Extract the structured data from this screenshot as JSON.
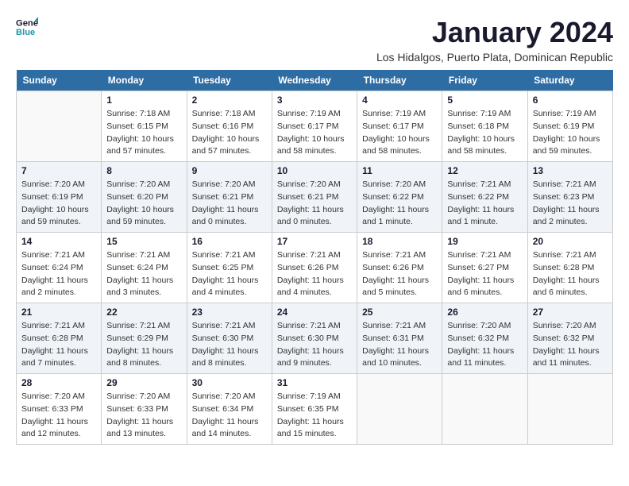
{
  "logo": {
    "line1": "General",
    "line2": "Blue"
  },
  "title": "January 2024",
  "subtitle": "Los Hidalgos, Puerto Plata, Dominican Republic",
  "days_of_week": [
    "Sunday",
    "Monday",
    "Tuesday",
    "Wednesday",
    "Thursday",
    "Friday",
    "Saturday"
  ],
  "weeks": [
    [
      {
        "day": "",
        "info": ""
      },
      {
        "day": "1",
        "info": "Sunrise: 7:18 AM\nSunset: 6:15 PM\nDaylight: 10 hours\nand 57 minutes."
      },
      {
        "day": "2",
        "info": "Sunrise: 7:18 AM\nSunset: 6:16 PM\nDaylight: 10 hours\nand 57 minutes."
      },
      {
        "day": "3",
        "info": "Sunrise: 7:19 AM\nSunset: 6:17 PM\nDaylight: 10 hours\nand 58 minutes."
      },
      {
        "day": "4",
        "info": "Sunrise: 7:19 AM\nSunset: 6:17 PM\nDaylight: 10 hours\nand 58 minutes."
      },
      {
        "day": "5",
        "info": "Sunrise: 7:19 AM\nSunset: 6:18 PM\nDaylight: 10 hours\nand 58 minutes."
      },
      {
        "day": "6",
        "info": "Sunrise: 7:19 AM\nSunset: 6:19 PM\nDaylight: 10 hours\nand 59 minutes."
      }
    ],
    [
      {
        "day": "7",
        "info": "Sunrise: 7:20 AM\nSunset: 6:19 PM\nDaylight: 10 hours\nand 59 minutes."
      },
      {
        "day": "8",
        "info": "Sunrise: 7:20 AM\nSunset: 6:20 PM\nDaylight: 10 hours\nand 59 minutes."
      },
      {
        "day": "9",
        "info": "Sunrise: 7:20 AM\nSunset: 6:21 PM\nDaylight: 11 hours\nand 0 minutes."
      },
      {
        "day": "10",
        "info": "Sunrise: 7:20 AM\nSunset: 6:21 PM\nDaylight: 11 hours\nand 0 minutes."
      },
      {
        "day": "11",
        "info": "Sunrise: 7:20 AM\nSunset: 6:22 PM\nDaylight: 11 hours\nand 1 minute."
      },
      {
        "day": "12",
        "info": "Sunrise: 7:21 AM\nSunset: 6:22 PM\nDaylight: 11 hours\nand 1 minute."
      },
      {
        "day": "13",
        "info": "Sunrise: 7:21 AM\nSunset: 6:23 PM\nDaylight: 11 hours\nand 2 minutes."
      }
    ],
    [
      {
        "day": "14",
        "info": "Sunrise: 7:21 AM\nSunset: 6:24 PM\nDaylight: 11 hours\nand 2 minutes."
      },
      {
        "day": "15",
        "info": "Sunrise: 7:21 AM\nSunset: 6:24 PM\nDaylight: 11 hours\nand 3 minutes."
      },
      {
        "day": "16",
        "info": "Sunrise: 7:21 AM\nSunset: 6:25 PM\nDaylight: 11 hours\nand 4 minutes."
      },
      {
        "day": "17",
        "info": "Sunrise: 7:21 AM\nSunset: 6:26 PM\nDaylight: 11 hours\nand 4 minutes."
      },
      {
        "day": "18",
        "info": "Sunrise: 7:21 AM\nSunset: 6:26 PM\nDaylight: 11 hours\nand 5 minutes."
      },
      {
        "day": "19",
        "info": "Sunrise: 7:21 AM\nSunset: 6:27 PM\nDaylight: 11 hours\nand 6 minutes."
      },
      {
        "day": "20",
        "info": "Sunrise: 7:21 AM\nSunset: 6:28 PM\nDaylight: 11 hours\nand 6 minutes."
      }
    ],
    [
      {
        "day": "21",
        "info": "Sunrise: 7:21 AM\nSunset: 6:28 PM\nDaylight: 11 hours\nand 7 minutes."
      },
      {
        "day": "22",
        "info": "Sunrise: 7:21 AM\nSunset: 6:29 PM\nDaylight: 11 hours\nand 8 minutes."
      },
      {
        "day": "23",
        "info": "Sunrise: 7:21 AM\nSunset: 6:30 PM\nDaylight: 11 hours\nand 8 minutes."
      },
      {
        "day": "24",
        "info": "Sunrise: 7:21 AM\nSunset: 6:30 PM\nDaylight: 11 hours\nand 9 minutes."
      },
      {
        "day": "25",
        "info": "Sunrise: 7:21 AM\nSunset: 6:31 PM\nDaylight: 11 hours\nand 10 minutes."
      },
      {
        "day": "26",
        "info": "Sunrise: 7:20 AM\nSunset: 6:32 PM\nDaylight: 11 hours\nand 11 minutes."
      },
      {
        "day": "27",
        "info": "Sunrise: 7:20 AM\nSunset: 6:32 PM\nDaylight: 11 hours\nand 11 minutes."
      }
    ],
    [
      {
        "day": "28",
        "info": "Sunrise: 7:20 AM\nSunset: 6:33 PM\nDaylight: 11 hours\nand 12 minutes."
      },
      {
        "day": "29",
        "info": "Sunrise: 7:20 AM\nSunset: 6:33 PM\nDaylight: 11 hours\nand 13 minutes."
      },
      {
        "day": "30",
        "info": "Sunrise: 7:20 AM\nSunset: 6:34 PM\nDaylight: 11 hours\nand 14 minutes."
      },
      {
        "day": "31",
        "info": "Sunrise: 7:19 AM\nSunset: 6:35 PM\nDaylight: 11 hours\nand 15 minutes."
      },
      {
        "day": "",
        "info": ""
      },
      {
        "day": "",
        "info": ""
      },
      {
        "day": "",
        "info": ""
      }
    ]
  ]
}
